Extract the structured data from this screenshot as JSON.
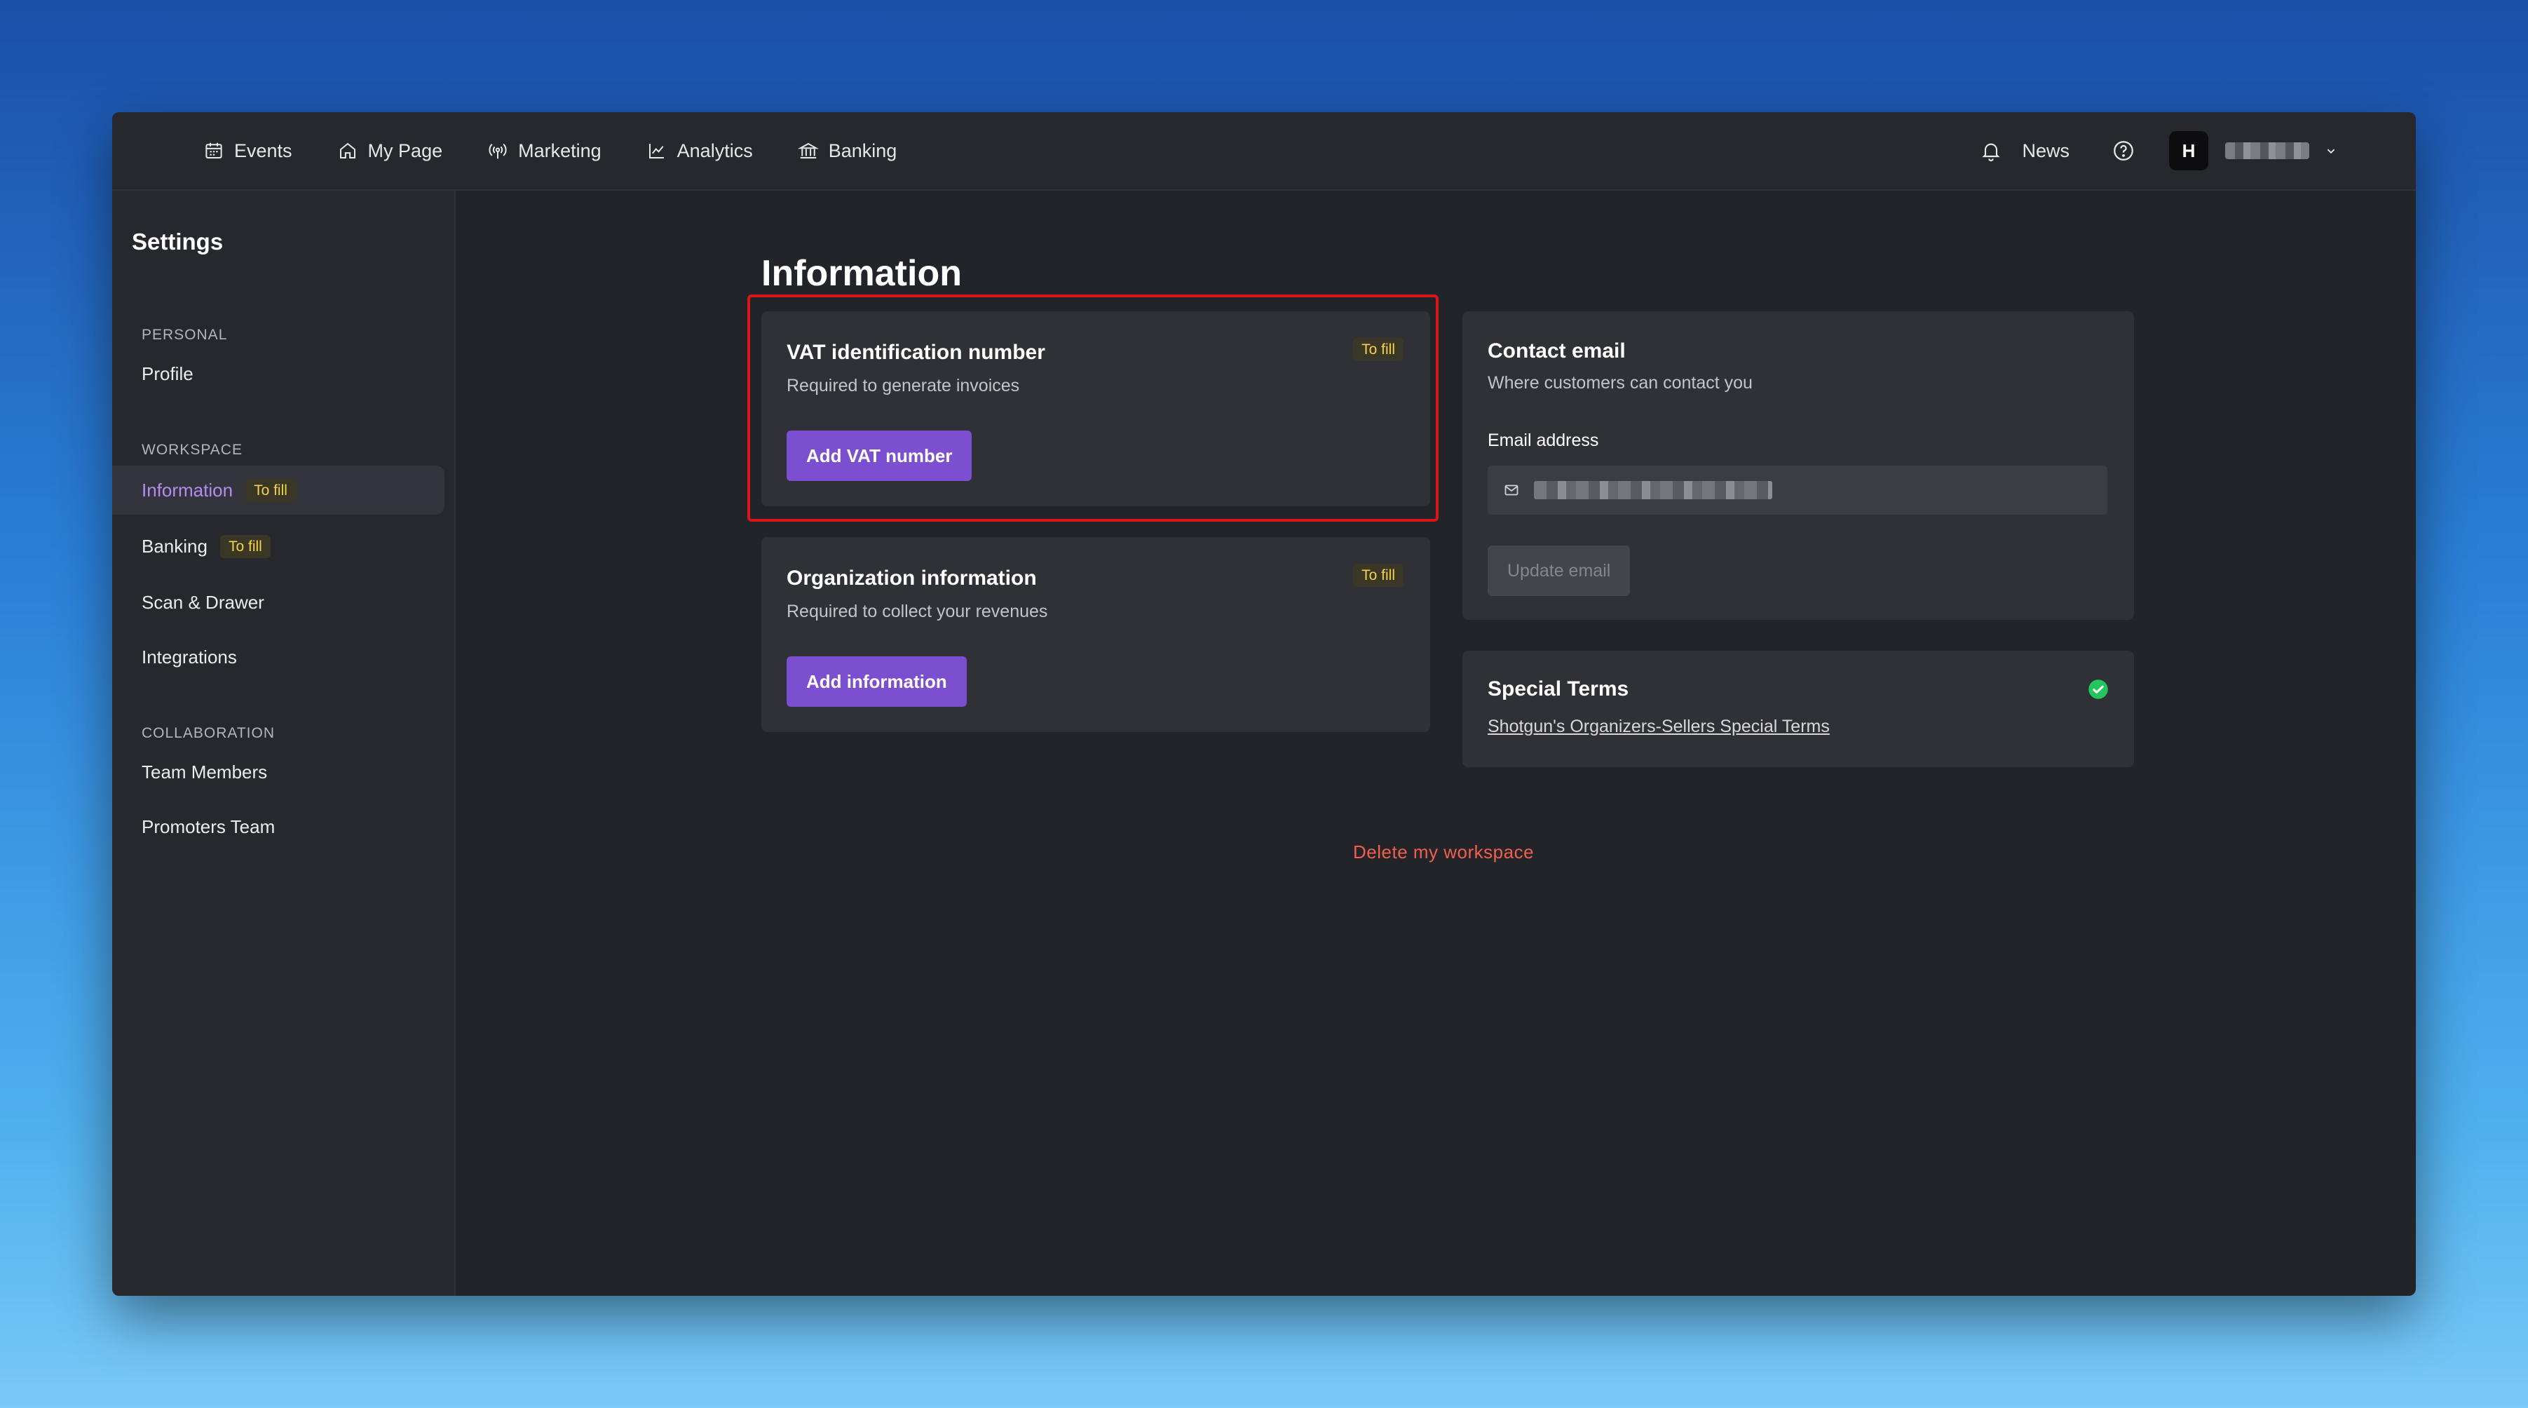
{
  "topnav": {
    "items": [
      {
        "label": "Events",
        "icon": "calendar-icon"
      },
      {
        "label": "My Page",
        "icon": "home-icon"
      },
      {
        "label": "Marketing",
        "icon": "broadcast-icon"
      },
      {
        "label": "Analytics",
        "icon": "chart-icon"
      },
      {
        "label": "Banking",
        "icon": "bank-icon"
      }
    ],
    "news_label": "News",
    "avatar_initial": "H"
  },
  "sidebar": {
    "title": "Settings",
    "sections": {
      "personal": "PERSONAL",
      "workspace": "WORKSPACE",
      "collaboration": "COLLABORATION"
    },
    "items": {
      "profile": "Profile",
      "information": "Information",
      "banking": "Banking",
      "scan_drawer": "Scan & Drawer",
      "integrations": "Integrations",
      "team_members": "Team Members",
      "promoters_team": "Promoters Team"
    },
    "badge_label": "To fill"
  },
  "main": {
    "title": "Information",
    "vat_card": {
      "title": "VAT identification number",
      "subtitle": "Required to generate invoices",
      "badge": "To fill",
      "button": "Add VAT number"
    },
    "org_card": {
      "title": "Organization information",
      "subtitle": "Required to collect your revenues",
      "badge": "To fill",
      "button": "Add information"
    },
    "contact_card": {
      "title": "Contact email",
      "subtitle": "Where customers can contact you",
      "field_label": "Email address",
      "button": "Update email"
    },
    "terms_card": {
      "title": "Special Terms",
      "link": "Shotgun's Organizers-Sellers Special Terms"
    },
    "delete_label": "Delete my workspace"
  },
  "colors": {
    "accent": "#7b4fd0",
    "badge_text": "#f4d24b",
    "danger": "#f0604c",
    "success": "#22c55e",
    "highlight": "#d9151a"
  }
}
